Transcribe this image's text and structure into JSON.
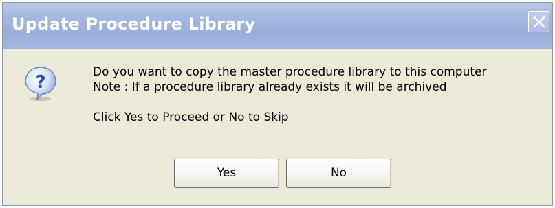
{
  "dialog": {
    "title": "Update Procedure Library",
    "icon": "question-icon",
    "close_icon": "close-icon",
    "message_lines": [
      "Do you want to copy the master procedure library to this computer",
      "Note : If a procedure library already exists it will be archived",
      "Click Yes to Proceed or No to Skip"
    ],
    "buttons": {
      "yes_label": "Yes",
      "no_label": "No"
    }
  },
  "colors": {
    "titlebar": "#a5b8df",
    "window_background": "#ece9d8",
    "icon_blue": "#2f6fd0"
  }
}
